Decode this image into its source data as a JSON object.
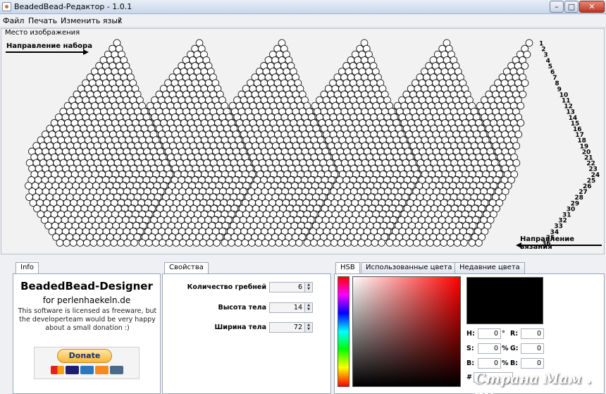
{
  "window": {
    "title": "BeadedBead-Редактор - 1.0.1",
    "min": "–",
    "max": "□",
    "close": "✕"
  },
  "menu": [
    "Файл",
    "Печать",
    "Изменить язык",
    "?"
  ],
  "canvas": {
    "label": "Место изображения",
    "direction_top": "Направление набора",
    "direction_bottom": "Направление вязания",
    "rows": 36,
    "teeth": 6,
    "bead_color": "#ffffff",
    "outline_color": "#1a1a1a"
  },
  "info": {
    "tab": "Info",
    "title": "BeadedBead-Designer",
    "subtitle": "for perlenhaekeln.de",
    "text": "This software is licensed as freeware, but the developerteam would be very happy about a small donation :)",
    "donate": "Donate"
  },
  "properties": {
    "tab": "Свойства",
    "items": [
      {
        "label": "Количество гребней",
        "value": "6"
      },
      {
        "label": "Высота тела",
        "value": "14"
      },
      {
        "label": "Ширина тела",
        "value": "72"
      }
    ]
  },
  "color": {
    "tabs": [
      "HSB",
      "Использованные цвета",
      "Недавние цвета"
    ],
    "preview": "#000000",
    "fields": [
      {
        "label": "H:",
        "value": "0",
        "unit": "°"
      },
      {
        "label": "S:",
        "value": "0",
        "unit": "%"
      },
      {
        "label": "B:",
        "value": "0",
        "unit": "%"
      }
    ],
    "rgb": [
      {
        "label": "R:",
        "value": "0"
      },
      {
        "label": "G:",
        "value": "0"
      },
      {
        "label": "B:",
        "value": "0"
      }
    ],
    "hex_prefix": "#"
  },
  "watermark": "Страна Мам . ру"
}
